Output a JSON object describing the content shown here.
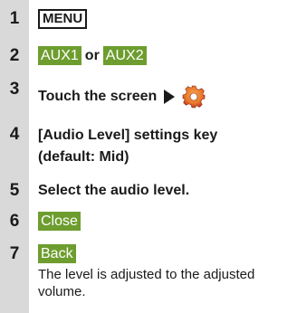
{
  "steps": [
    {
      "num": "1",
      "key": "MENU"
    },
    {
      "num": "2",
      "key_a": "AUX1",
      "joiner": "or",
      "key_b": "AUX2"
    },
    {
      "num": "3",
      "text": "Touch the screen",
      "icon": "settings-gear-icon"
    },
    {
      "num": "4",
      "line1": "[Audio Level] settings key",
      "line2": "(default: Mid)"
    },
    {
      "num": "5",
      "text": "Select the audio level."
    },
    {
      "num": "6",
      "key": "Close"
    },
    {
      "num": "7",
      "key": "Back",
      "note": "The level is adjusted to the adjusted volume."
    }
  ],
  "colors": {
    "rail": "#d9d9d9",
    "key_green": "#6e9d2f",
    "gear_orange": "#e8742a",
    "gear_red": "#c0392b"
  }
}
